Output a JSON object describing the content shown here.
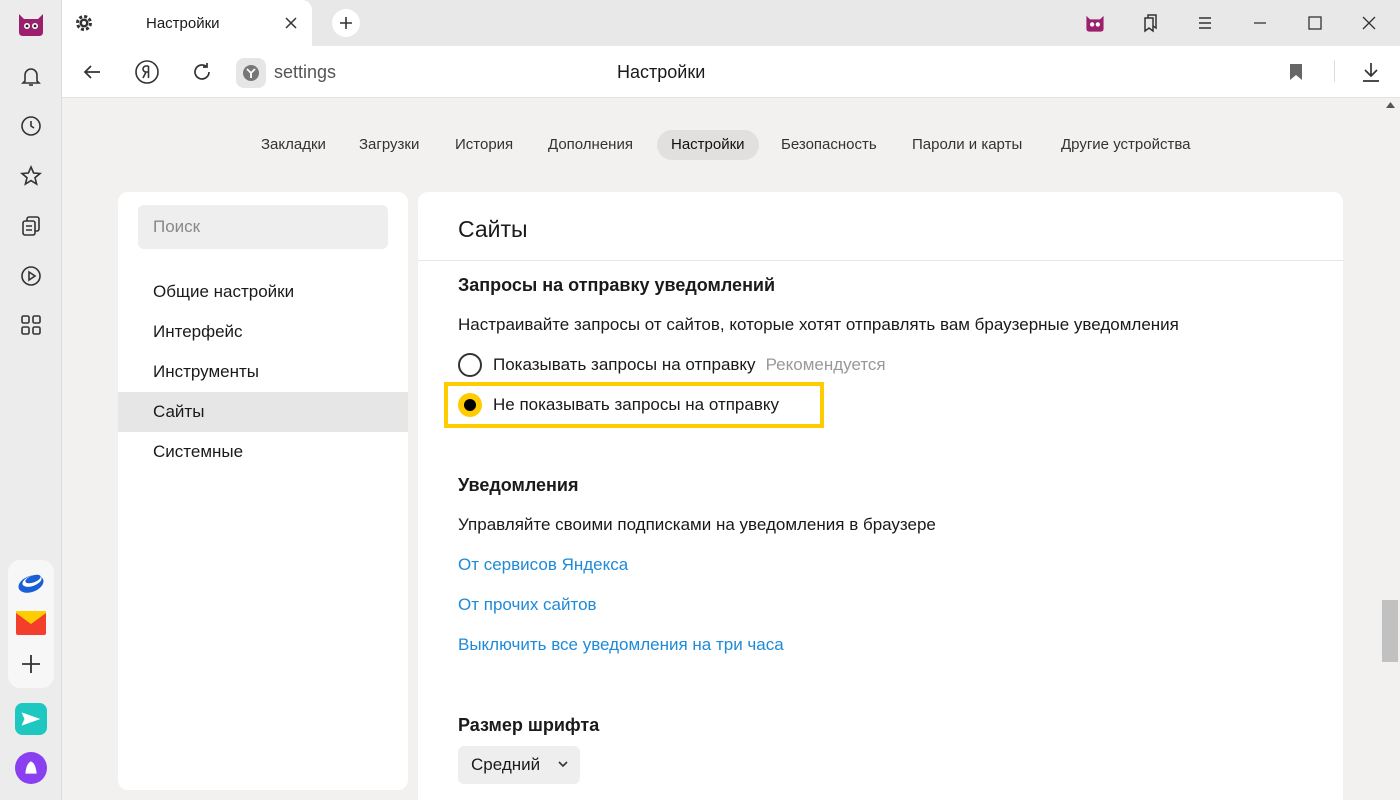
{
  "window": {
    "tab_title": "Настройки",
    "url": "settings",
    "page_title": "Настройки"
  },
  "nav_tabs": [
    {
      "label": "Закладки",
      "active": false
    },
    {
      "label": "Загрузки",
      "active": false
    },
    {
      "label": "История",
      "active": false
    },
    {
      "label": "Дополнения",
      "active": false
    },
    {
      "label": "Настройки",
      "active": true
    },
    {
      "label": "Безопасность",
      "active": false
    },
    {
      "label": "Пароли и карты",
      "active": false
    },
    {
      "label": "Другие устройства",
      "active": false
    }
  ],
  "sidebar": {
    "search_placeholder": "Поиск",
    "items": [
      {
        "label": "Общие настройки",
        "active": false
      },
      {
        "label": "Интерфейс",
        "active": false
      },
      {
        "label": "Инструменты",
        "active": false
      },
      {
        "label": "Сайты",
        "active": true
      },
      {
        "label": "Системные",
        "active": false
      }
    ]
  },
  "main": {
    "header": "Сайты",
    "notif_requests": {
      "title": "Запросы на отправку уведомлений",
      "description": "Настраивайте запросы от сайтов, которые хотят отправлять вам браузерные уведомления",
      "option_show": "Показывать запросы на отправку",
      "option_show_hint": "Рекомендуется",
      "option_hide": "Не показывать запросы на отправку",
      "selected": "option_hide"
    },
    "notifications": {
      "title": "Уведомления",
      "description": "Управляйте своими подписками на уведомления в браузере",
      "link_yandex": "От сервисов Яндекса",
      "link_other": "От прочих сайтов",
      "link_disable": "Выключить все уведомления на три часа"
    },
    "font_size": {
      "title": "Размер шрифта",
      "value": "Средний"
    }
  },
  "colors": {
    "accent": "#ffcc00",
    "link": "#1f8ad8"
  },
  "icons": [
    "browser-logo-icon",
    "bell-icon",
    "history-icon",
    "star-icon",
    "collections-icon",
    "play-icon",
    "apps-icon",
    "disk-icon",
    "mail-icon",
    "plus-icon",
    "messenger-icon",
    "alice-icon",
    "gear-icon",
    "close-icon",
    "back-icon",
    "yandex-icon",
    "reload-icon",
    "bookmark-icon",
    "download-icon"
  ]
}
